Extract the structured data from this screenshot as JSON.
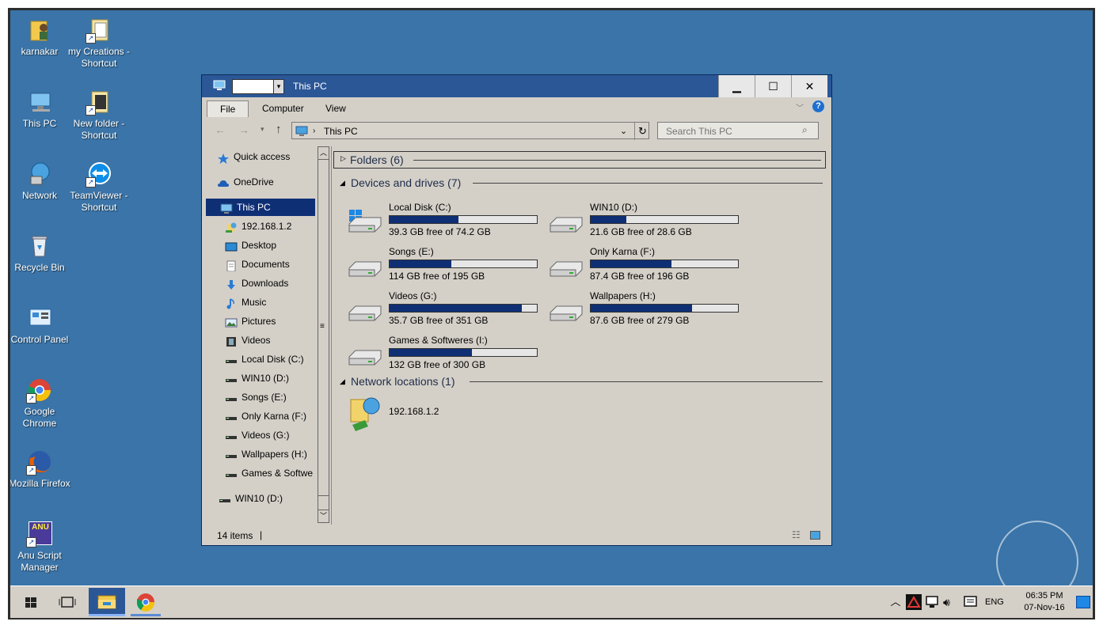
{
  "desktop": {
    "icons": [
      {
        "label": "karnakar",
        "icon": "user-folder-icon"
      },
      {
        "label": "my Creations - Shortcut",
        "icon": "folder-shortcut-icon"
      },
      {
        "label": "This PC",
        "icon": "computer-icon"
      },
      {
        "label": "New folder - Shortcut",
        "icon": "folder-shortcut-icon"
      },
      {
        "label": "Network",
        "icon": "network-icon"
      },
      {
        "label": "TeamViewer - Shortcut",
        "icon": "teamviewer-icon"
      },
      {
        "label": "Recycle Bin",
        "icon": "recycle-bin-icon"
      },
      {
        "label": "Control Panel",
        "icon": "control-panel-icon"
      },
      {
        "label": "Google Chrome",
        "icon": "chrome-icon"
      },
      {
        "label": "Mozilla Firefox",
        "icon": "firefox-icon"
      },
      {
        "label": "Anu Script Manager",
        "icon": "anu-icon",
        "badge": "ANU"
      }
    ]
  },
  "window": {
    "title": "This PC",
    "buttons": {
      "minimize": "▁",
      "maximize": "☐",
      "close": "✕"
    },
    "ribbon": {
      "tabs": [
        "File",
        "Computer",
        "View"
      ]
    },
    "address": {
      "path": "This PC"
    },
    "search": {
      "placeholder": "Search This PC"
    },
    "nav": {
      "items": [
        {
          "label": "Quick access",
          "icon": "star-icon"
        },
        {
          "label": "OneDrive",
          "icon": "cloud-icon"
        },
        {
          "label": "This PC",
          "icon": "computer-icon",
          "selected": true
        },
        {
          "label": "192.168.1.2",
          "icon": "network-folder-icon"
        },
        {
          "label": "Desktop",
          "icon": "desktop-icon"
        },
        {
          "label": "Documents",
          "icon": "documents-icon"
        },
        {
          "label": "Downloads",
          "icon": "downloads-icon"
        },
        {
          "label": "Music",
          "icon": "music-icon"
        },
        {
          "label": "Pictures",
          "icon": "pictures-icon"
        },
        {
          "label": "Videos",
          "icon": "videos-icon"
        },
        {
          "label": "Local Disk (C:)",
          "icon": "drive-icon"
        },
        {
          "label": "WIN10 (D:)",
          "icon": "drive-icon"
        },
        {
          "label": "Songs (E:)",
          "icon": "drive-icon"
        },
        {
          "label": "Only Karna (F:)",
          "icon": "drive-icon"
        },
        {
          "label": "Videos (G:)",
          "icon": "drive-icon"
        },
        {
          "label": "Wallpapers (H:)",
          "icon": "drive-icon"
        },
        {
          "label": "Games & Softwe",
          "icon": "drive-icon"
        },
        {
          "label": "WIN10 (D:)",
          "icon": "drive-icon"
        }
      ]
    },
    "groups": {
      "folders": "Folders (6)",
      "devices": "Devices and drives (7)",
      "network": "Network locations (1)"
    },
    "drives": [
      {
        "name": "Local Disk (C:)",
        "free": "39.3 GB free of 74.2 GB",
        "used_fraction": 0.47,
        "windows": true
      },
      {
        "name": "WIN10 (D:)",
        "free": "21.6 GB free of 28.6 GB",
        "used_fraction": 0.24
      },
      {
        "name": "Songs (E:)",
        "free": "114 GB free of 195 GB",
        "used_fraction": 0.42
      },
      {
        "name": "Only Karna (F:)",
        "free": "87.4 GB free of 196 GB",
        "used_fraction": 0.55
      },
      {
        "name": "Videos (G:)",
        "free": "35.7 GB free of 351 GB",
        "used_fraction": 0.9
      },
      {
        "name": "Wallpapers (H:)",
        "free": "87.6 GB free of 279 GB",
        "used_fraction": 0.69
      },
      {
        "name": "Games & Softweres (I:)",
        "free": "132 GB free of 300 GB",
        "used_fraction": 0.56
      }
    ],
    "network_location": {
      "name": "192.168.1.2"
    },
    "status": {
      "items": "14 items"
    }
  },
  "taskbar": {
    "lang": "ENG",
    "time": "06:35 PM",
    "date": "07-Nov-16"
  },
  "colors": {
    "desktop": "#3a74a8",
    "title": "#2b5797",
    "bar": "#0f2f75"
  }
}
